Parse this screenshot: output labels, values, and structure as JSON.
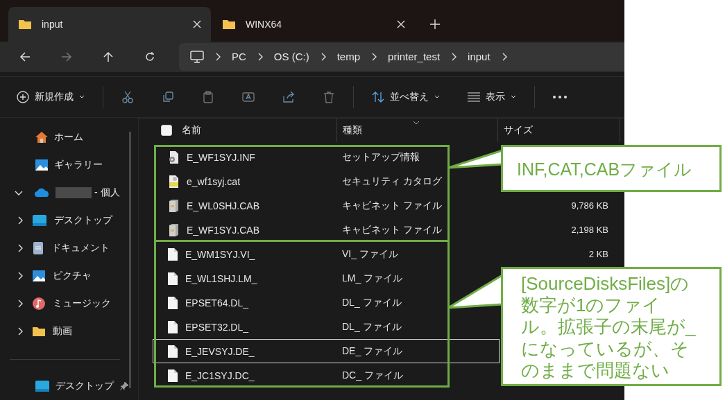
{
  "tabs": [
    {
      "label": "input",
      "selected": true
    },
    {
      "label": "WINX64",
      "selected": false
    }
  ],
  "breadcrumb": [
    "PC",
    "OS (C:)",
    "temp",
    "printer_test",
    "input"
  ],
  "toolbar": {
    "new_button": "新規作成",
    "sort_button": "並べ替え",
    "view_button": "表示"
  },
  "sidebar": {
    "items": [
      {
        "label": "ホーム",
        "kind": "home"
      },
      {
        "label": "ギャラリー",
        "kind": "gallery"
      },
      {
        "label": "- 個人",
        "kind": "cloud",
        "expanded": true,
        "children": [
          {
            "label": "デスクトップ",
            "kind": "desktop",
            "expanded": false
          },
          {
            "label": "ドキュメント",
            "kind": "documents",
            "expanded": false
          },
          {
            "label": "ピクチャ",
            "kind": "pictures",
            "expanded": false
          },
          {
            "label": "ミュージック",
            "kind": "music",
            "expanded": false
          },
          {
            "label": "動画",
            "kind": "videos",
            "expanded": false
          }
        ]
      }
    ],
    "pinned": [
      {
        "label": "デスクトップ",
        "kind": "desktop"
      }
    ]
  },
  "columns": [
    "名前",
    "種類",
    "サイズ"
  ],
  "all_selected": false,
  "groups": [
    {
      "callout": "INF,CAT,CABファイル",
      "files": [
        {
          "name": "E_WF1SYJ.INF",
          "type": "セットアップ情報",
          "kind": "inf",
          "selected": false
        },
        {
          "name": "e_wf1syj.cat",
          "type": "セキュリティ カタログ",
          "kind": "cat",
          "selected": false
        },
        {
          "name": "E_WL0SHJ.CAB",
          "type": "キャビネット ファイル",
          "size": "9,786 KB",
          "kind": "cab",
          "selected": false
        },
        {
          "name": "E_WF1SYJ.CAB",
          "type": "キャビネット ファイル",
          "size": "2,198 KB",
          "kind": "cab",
          "selected": false
        }
      ]
    },
    {
      "callout": "[SourceDisksFiles]の数字が1のファイル。拡張子の末尾が_になっているが、そのままで問題ない",
      "files": [
        {
          "name": "E_WM1SYJ.VI_",
          "type": "VI_ ファイル",
          "size": "2 KB",
          "kind": "file",
          "selected": false
        },
        {
          "name": "E_WL1SHJ.LM_",
          "type": "LM_ ファイル",
          "kind": "file",
          "selected": false
        },
        {
          "name": "EPSET64.DL_",
          "type": "DL_ ファイル",
          "kind": "file",
          "selected": false
        },
        {
          "name": "EPSET32.DL_",
          "type": "DL_ ファイル",
          "kind": "file",
          "selected": false
        },
        {
          "name": "E_JEVSYJ.DE_",
          "type": "DE_ ファイル",
          "kind": "file",
          "selected": true
        },
        {
          "name": "E_JC1SYJ.DC_",
          "type": "DC_ ファイル",
          "kind": "file",
          "selected": false
        }
      ]
    }
  ]
}
